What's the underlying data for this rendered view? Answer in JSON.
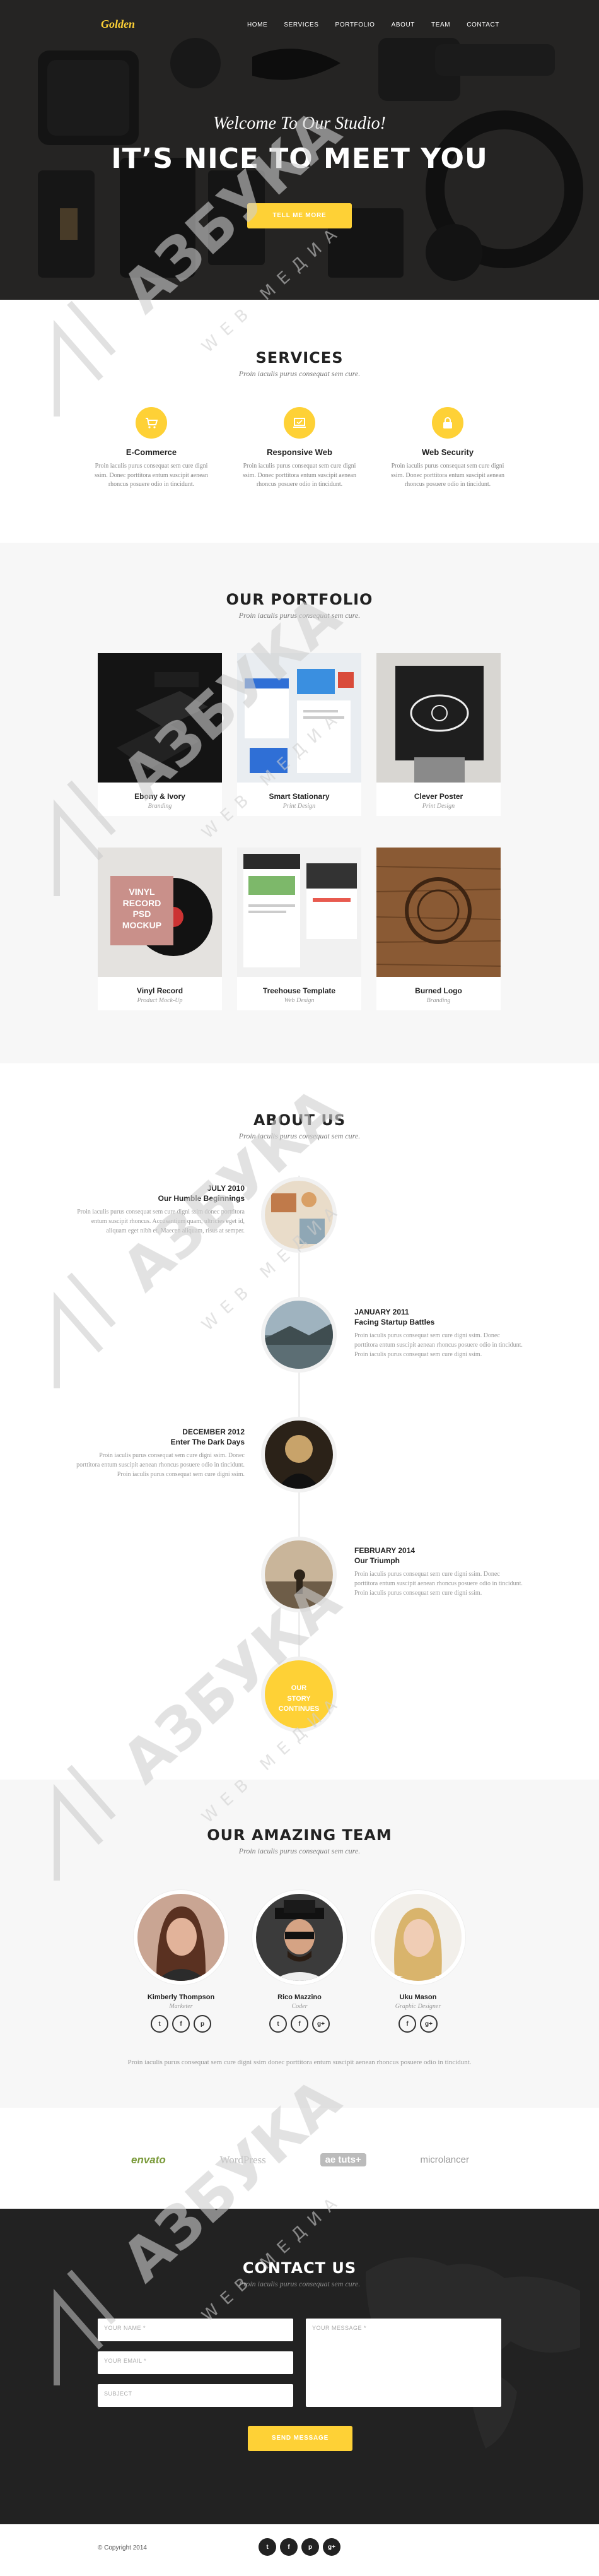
{
  "brand": {
    "logo": "Golden",
    "accent": "#fed136"
  },
  "nav": {
    "items": [
      "HOME",
      "SERVICES",
      "PORTFOLIO",
      "ABOUT",
      "TEAM",
      "CONTACT"
    ]
  },
  "hero": {
    "subtitle": "Welcome To Our Studio!",
    "title": "IT’S NICE TO MEET YOU",
    "button": "TELL ME MORE"
  },
  "services": {
    "title": "SERVICES",
    "subtitle": "Proin iaculis purus consequat sem cure.",
    "items": [
      {
        "icon": "cart-icon",
        "title": "E-Commerce",
        "text": "Proin iaculis purus consequat sem cure digni ssim. Donec porttitora entum suscipit aenean rhoncus posuere odio in tincidunt."
      },
      {
        "icon": "laptop-icon",
        "title": "Responsive Web",
        "text": "Proin iaculis purus consequat sem cure digni ssim. Donec porttitora entum suscipit aenean rhoncus posuere odio in tincidunt."
      },
      {
        "icon": "lock-icon",
        "title": "Web Security",
        "text": "Proin iaculis purus consequat sem cure digni ssim. Donec porttitora entum suscipit aenean rhoncus posuere odio in tincidunt."
      }
    ]
  },
  "portfolio": {
    "title": "OUR PORTFOLIO",
    "subtitle": "Proin iaculis purus consequat sem cure.",
    "items": [
      {
        "title": "Ebony & Ivory",
        "category": "Branding"
      },
      {
        "title": "Smart Stationary",
        "category": "Print Design"
      },
      {
        "title": "Clever Poster",
        "category": "Print Design"
      },
      {
        "title": "Vinyl Record",
        "category": "Product Mock-Up"
      },
      {
        "title": "Treehouse Template",
        "category": "Web Design"
      },
      {
        "title": "Burned Logo",
        "category": "Branding"
      }
    ],
    "vinyl_text": [
      "VINYL",
      "RECORD",
      "PSD",
      "MOCKUP"
    ]
  },
  "about": {
    "title": "ABOUT US",
    "subtitle": "Proin iaculis purus consequat sem cure.",
    "timeline": [
      {
        "date": "JULY 2010",
        "heading": "Our Humble Beginnings",
        "text": "Proin iaculis purus consequat sem cure digni ssim donec porttitora entum suscipit rhoncus. Accusantium quam, ultricies eget id, aliquam eget nibh et. Maecen aliquam, risus at semper."
      },
      {
        "date": "JANUARY 2011",
        "heading": "Facing Startup Battles",
        "text": "Proin iaculis purus consequat sem cure digni ssim. Donec porttitora entum suscipit aenean rhoncus posuere odio in tincidunt. Proin iaculis purus consequat sem cure digni ssim."
      },
      {
        "date": "DECEMBER 2012",
        "heading": "Enter The Dark Days",
        "text": "Proin iaculis purus consequat sem cure digni ssim. Donec porttitora entum suscipit aenean rhoncus posuere odio in tincidunt. Proin iaculis purus consequat sem cure digni ssim."
      },
      {
        "date": "FEBRUARY 2014",
        "heading": "Our Triumph",
        "text": "Proin iaculis purus consequat sem cure digni ssim. Donec porttitora entum suscipit aenean rhoncus posuere odio in tincidunt. Proin iaculis purus consequat sem cure digni ssim."
      }
    ],
    "story": [
      "OUR",
      "STORY",
      "CONTINUES"
    ]
  },
  "team": {
    "title": "OUR AMAZING TEAM",
    "subtitle": "Proin iaculis purus consequat sem cure.",
    "members": [
      {
        "name": "Kimberly Thompson",
        "role": "Marketer",
        "social": [
          "t",
          "f",
          "p"
        ]
      },
      {
        "name": "Rico Mazzino",
        "role": "Coder",
        "social": [
          "t",
          "f",
          "g+"
        ]
      },
      {
        "name": "Uku Mason",
        "role": "Graphic Designer",
        "social": [
          "f",
          "g+"
        ]
      }
    ],
    "note": "Proin iaculis purus consequat sem cure digni ssim donec porttitora entum suscipit aenean rhoncus posuere odio in tincidunt."
  },
  "clients": [
    "envato",
    "WordPress",
    "ae tuts+",
    "microlancer"
  ],
  "contact": {
    "title": "CONTACT US",
    "subtitle": "Proin iaculis purus consequat sem cure.",
    "name_placeholder": "YOUR NAME *",
    "email_placeholder": "YOUR EMAIL *",
    "subject_placeholder": "SUBJECT",
    "message_placeholder": "YOUR MESSAGE *",
    "button": "SEND MESSAGE"
  },
  "footer": {
    "copyright": "© Copyright 2014",
    "social": [
      "t",
      "f",
      "p",
      "g+"
    ]
  },
  "watermark": {
    "text": "АЗБУКА",
    "subtext": "WEB МЕДИА"
  }
}
